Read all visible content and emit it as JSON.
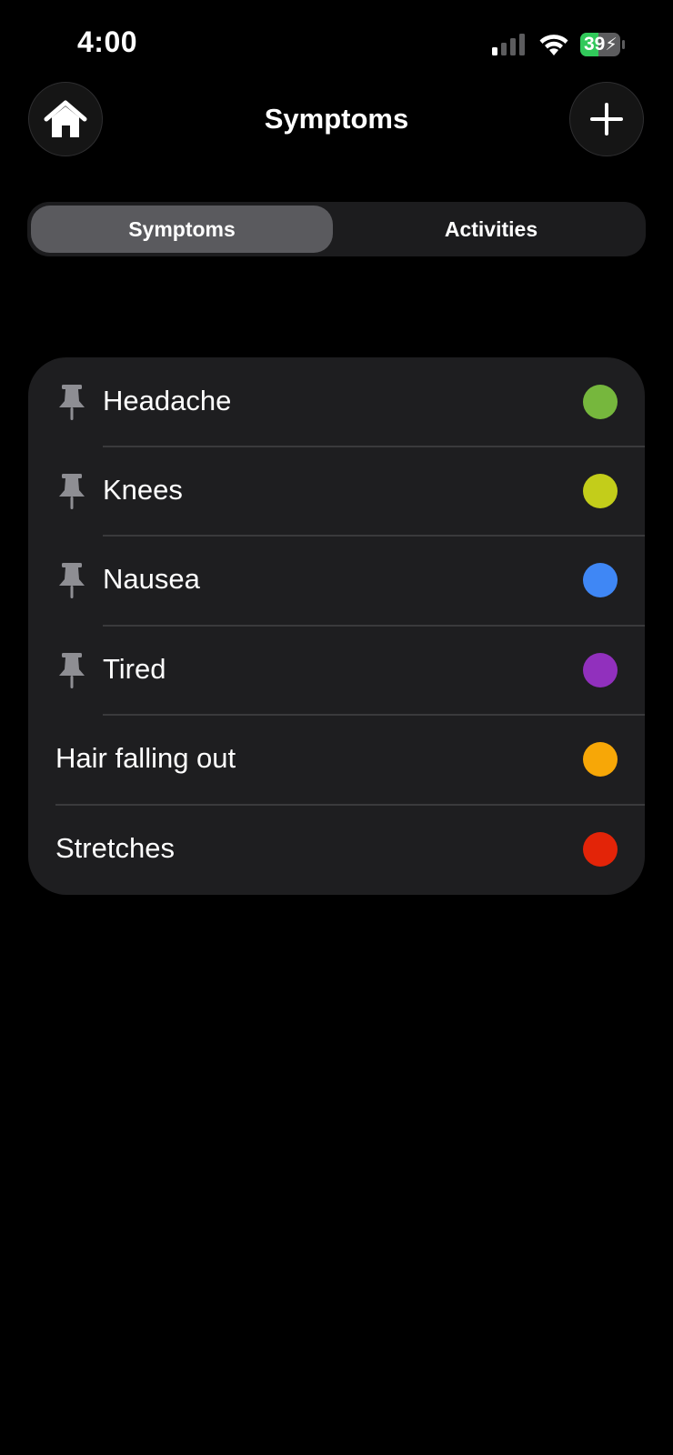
{
  "status_bar": {
    "time": "4:00",
    "battery_level": "39",
    "battery_charging": true
  },
  "nav": {
    "title": "Symptoms"
  },
  "segmented": {
    "options": [
      "Symptoms",
      "Activities"
    ],
    "selected": "Symptoms"
  },
  "symptoms": [
    {
      "label": "Headache",
      "pinned": true,
      "color": "#76b73d"
    },
    {
      "label": "Knees",
      "pinned": true,
      "color": "#c3cd1a"
    },
    {
      "label": "Nausea",
      "pinned": true,
      "color": "#3f87f5"
    },
    {
      "label": "Tired",
      "pinned": true,
      "color": "#9130bd"
    },
    {
      "label": "Hair falling out",
      "pinned": false,
      "color": "#f7a707"
    },
    {
      "label": "Stretches",
      "pinned": false,
      "color": "#e32408"
    }
  ],
  "icons": {
    "home": "house-icon",
    "add": "plus-icon",
    "pin": "pushpin-icon"
  }
}
